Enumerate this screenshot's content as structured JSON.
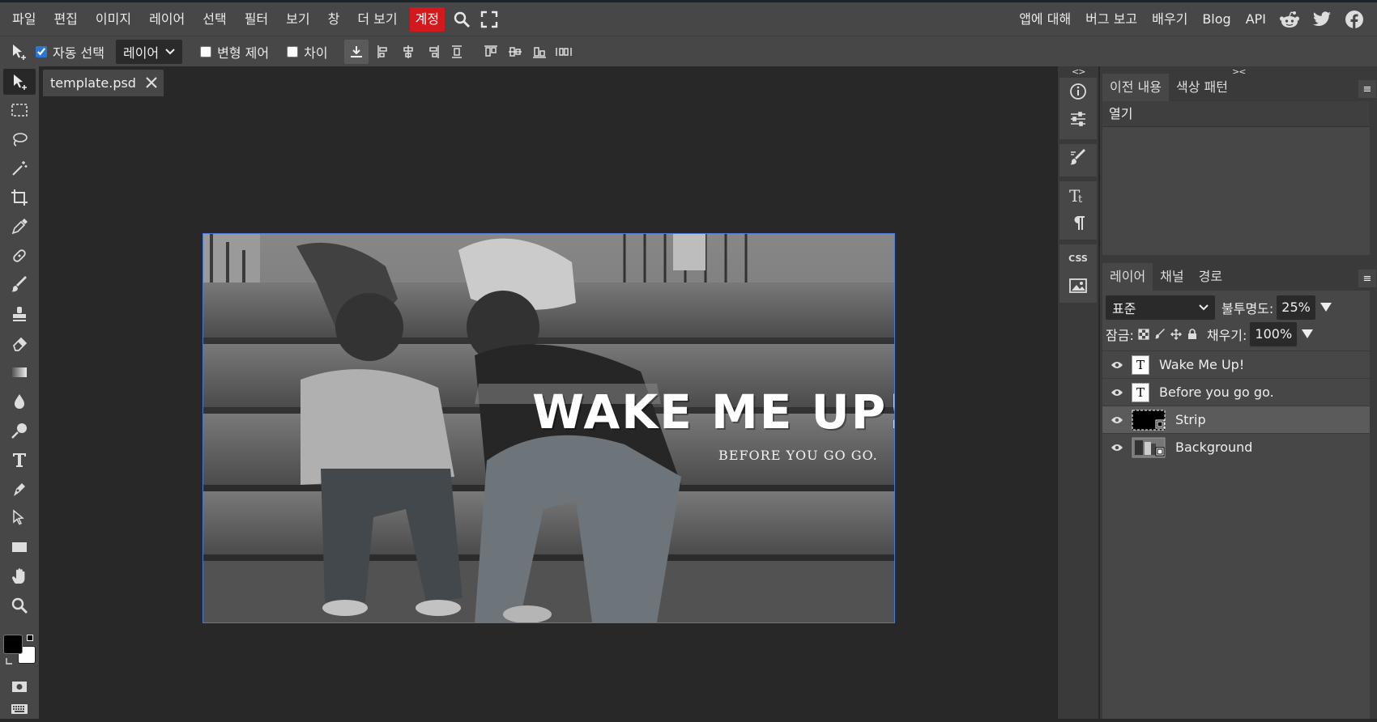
{
  "menubar": {
    "items": [
      "파일",
      "편집",
      "이미지",
      "레이어",
      "선택",
      "필터",
      "보기",
      "창",
      "더 보기"
    ],
    "account": "계정",
    "right_items": [
      "앱에 대해",
      "버그 보고",
      "배우기",
      "Blog",
      "API"
    ],
    "social_icons": [
      "reddit-icon",
      "twitter-icon",
      "facebook-icon"
    ]
  },
  "options": {
    "auto_select_label": "자동 선택",
    "auto_select_checked": true,
    "target_value": "레이어",
    "transform_label": "변형 제어",
    "transform_checked": false,
    "diff_label": "차이",
    "diff_checked": false
  },
  "document": {
    "tab_name": "template.psd",
    "title_text": "WAKE ME UP!",
    "subtitle_text": "BEFORE YOU GO GO."
  },
  "iconcol": {
    "collapse": "<>",
    "css_label": "CSS"
  },
  "history": {
    "tabs": [
      "이전 내용",
      "색상 패턴"
    ],
    "collapse": "><",
    "menu": "≡",
    "rows": [
      "열기"
    ]
  },
  "layers": {
    "tabs": [
      "레이어",
      "채널",
      "경로"
    ],
    "menu": "≡",
    "blend_mode": "표준",
    "opacity_label": "불투명도:",
    "opacity_value": "25%",
    "lock_label": "잠금:",
    "fill_label": "채우기:",
    "fill_value": "100%",
    "items": [
      {
        "name": "Wake Me Up!",
        "type": "text",
        "visible": true,
        "selected": false
      },
      {
        "name": "Before you go go.",
        "type": "text",
        "visible": true,
        "selected": false
      },
      {
        "name": "Strip",
        "type": "shape",
        "visible": true,
        "selected": true
      },
      {
        "name": "Background",
        "type": "image",
        "visible": true,
        "selected": false
      }
    ]
  },
  "colors": {
    "foreground": "#000000",
    "background": "#ffffff",
    "accent": "#d3191c",
    "selection_border": "#4a78d8"
  }
}
